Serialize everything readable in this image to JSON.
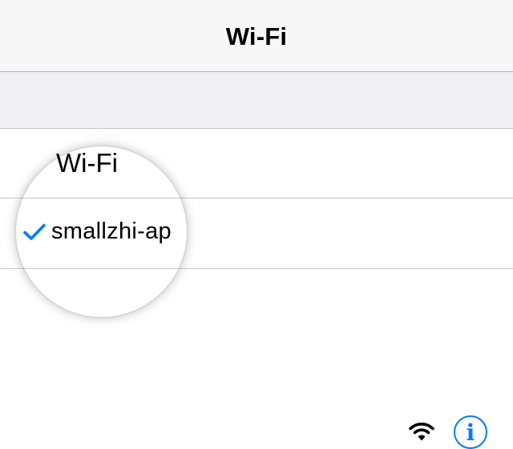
{
  "nav": {
    "title": "Wi-Fi"
  },
  "wifi_toggle": {
    "label": "Wi-Fi",
    "state": "on",
    "on_color": "#4cd964"
  },
  "network": {
    "name": "smallzhi-ap",
    "connected": true,
    "signal_icon": "wifi-signal-icon",
    "info_glyph": "i",
    "accent_color": "#007aff"
  }
}
